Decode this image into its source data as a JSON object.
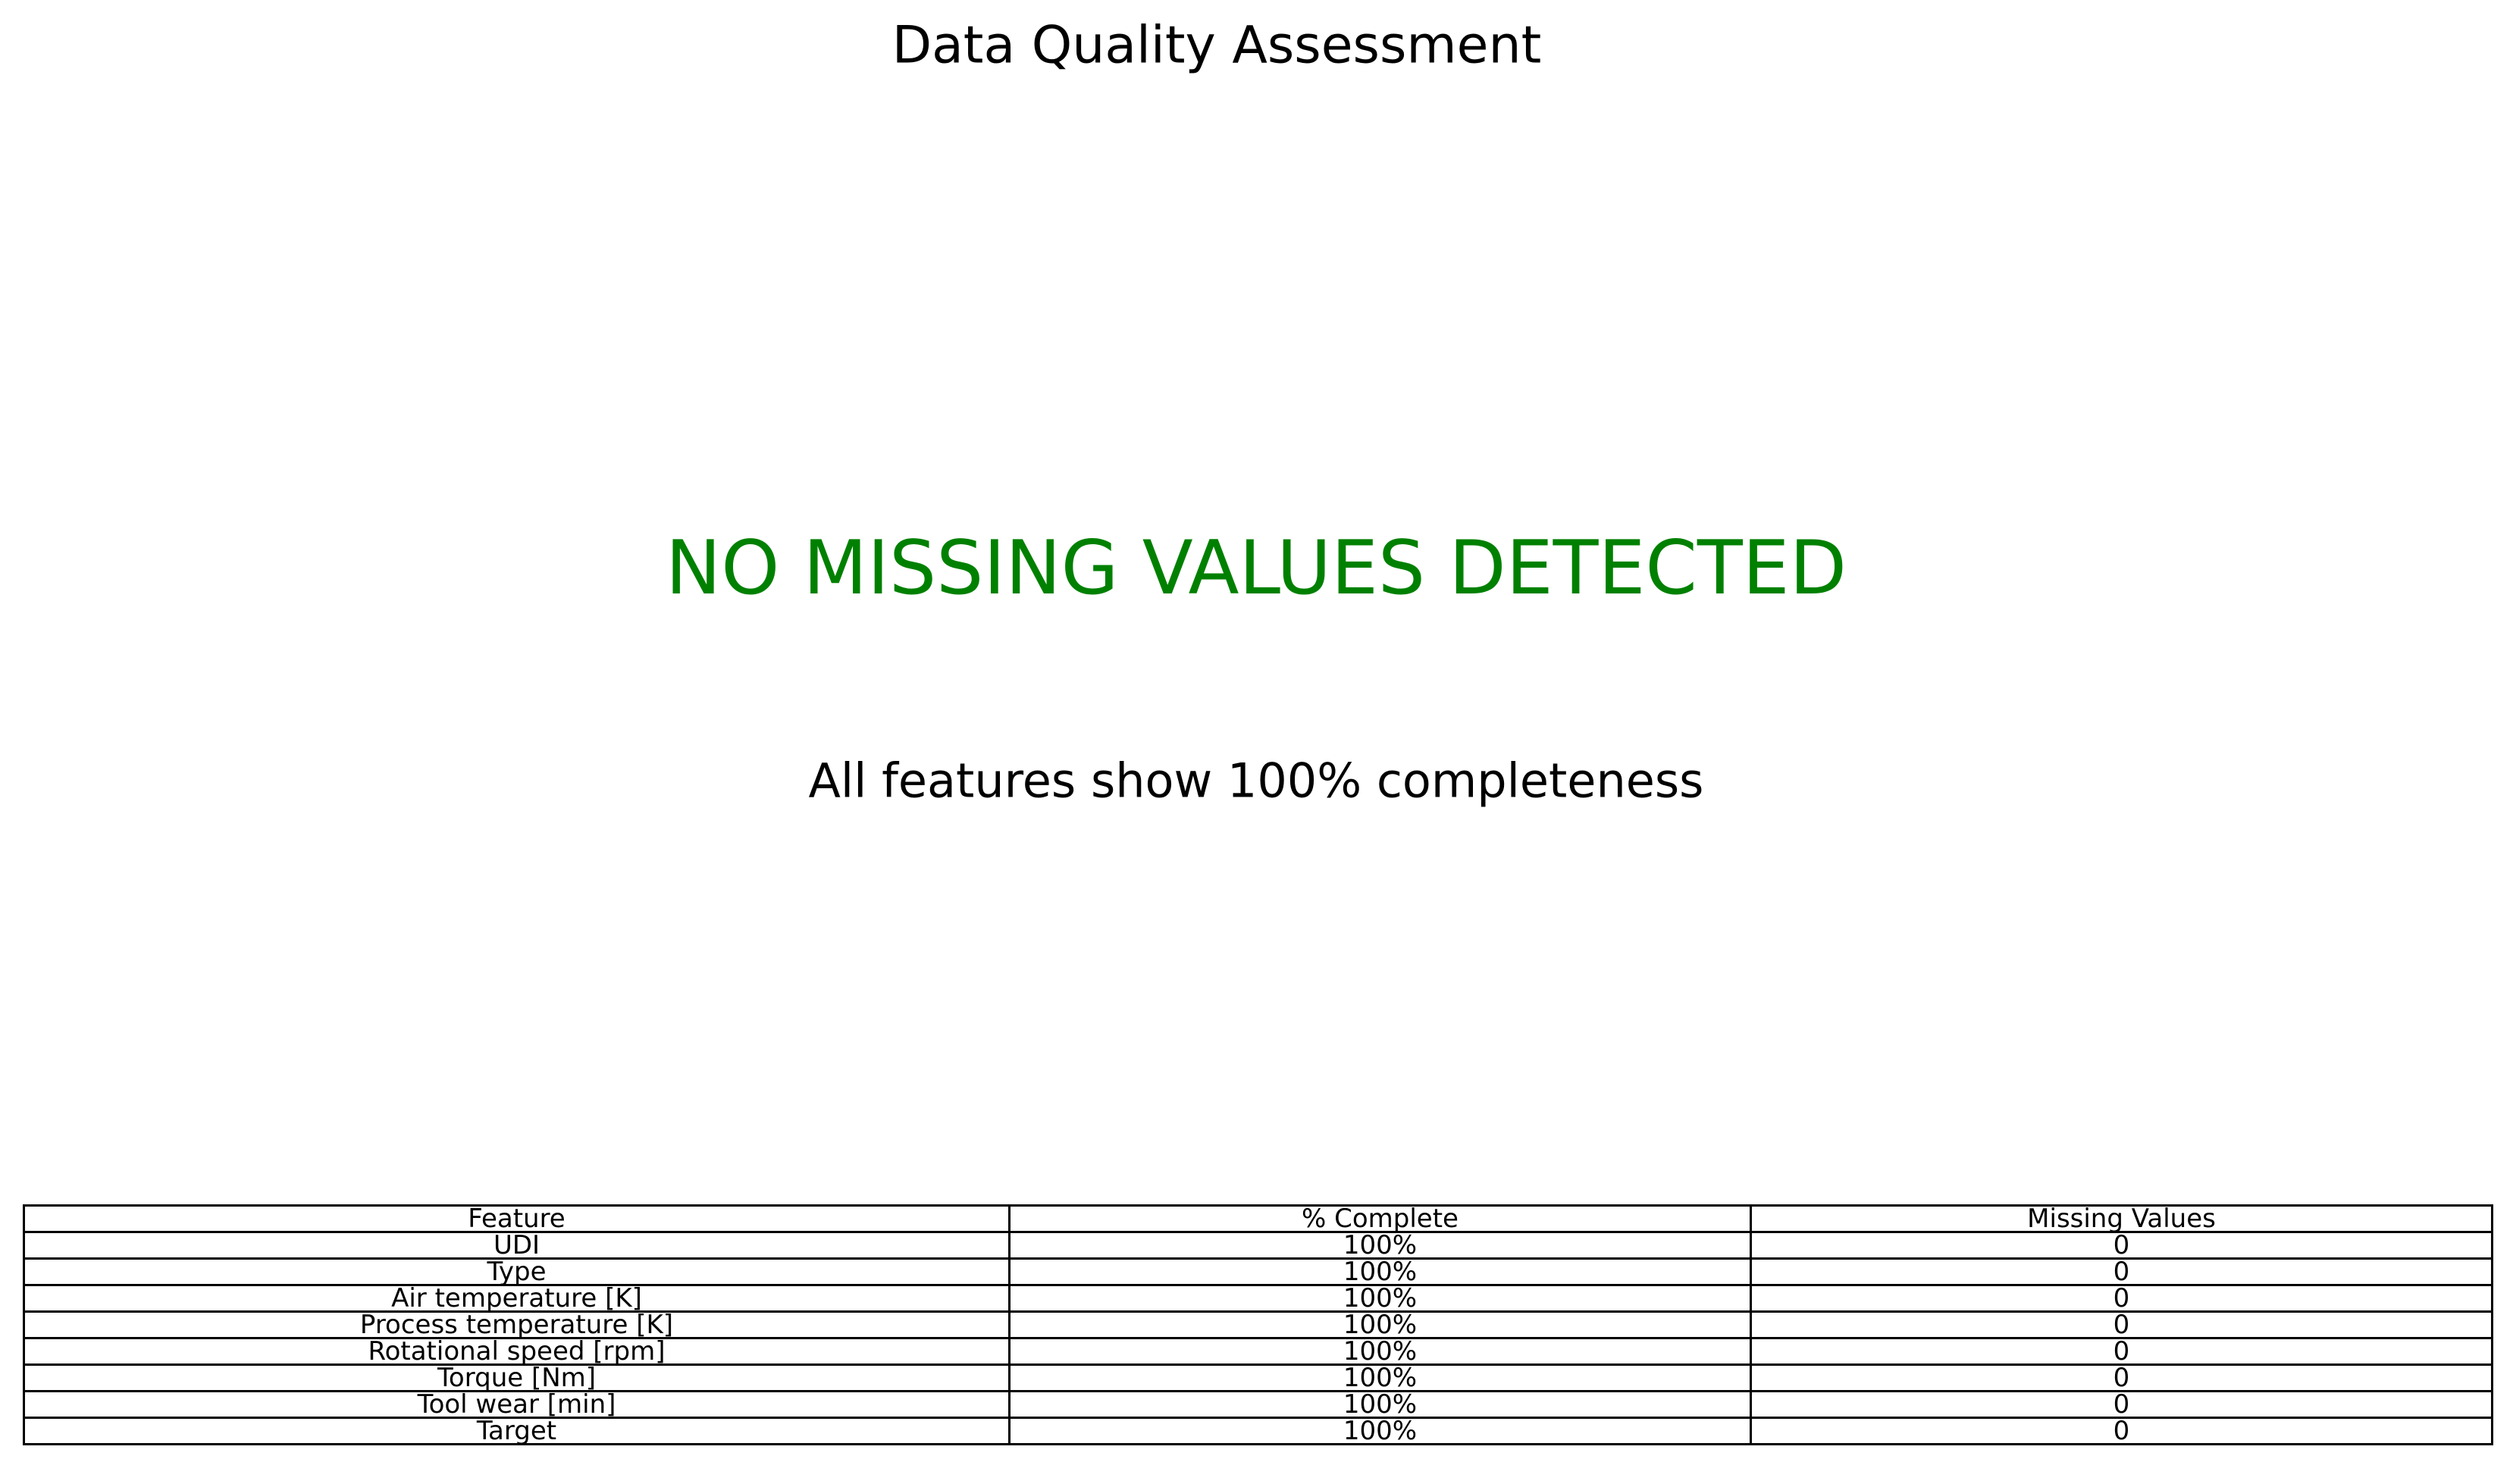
{
  "chart_data": {
    "type": "table",
    "title": "Data Quality Assessment",
    "annotation": "NO MISSING VALUES DETECTED",
    "subtitle": "All features show 100% completeness",
    "colors": {
      "annotation": "#008000"
    },
    "columns": [
      "Feature",
      "% Complete",
      "Missing Values"
    ],
    "rows": [
      [
        "UDI",
        "100%",
        "0"
      ],
      [
        "Type",
        "100%",
        "0"
      ],
      [
        "Air temperature [K]",
        "100%",
        "0"
      ],
      [
        "Process temperature [K]",
        "100%",
        "0"
      ],
      [
        "Rotational speed [rpm]",
        "100%",
        "0"
      ],
      [
        "Torque [Nm]",
        "100%",
        "0"
      ],
      [
        "Tool wear [min]",
        "100%",
        "0"
      ],
      [
        "Target",
        "100%",
        "0"
      ]
    ]
  }
}
